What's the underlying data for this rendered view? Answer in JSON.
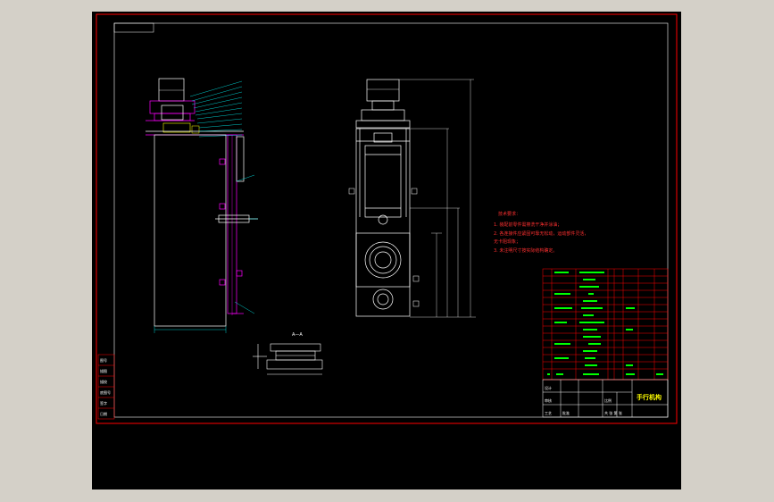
{
  "viewer": {
    "background": "#000000",
    "frame_color": "#ff0000",
    "line_color": "#ffffff",
    "part_color": "#ff00ff",
    "dim_color": "#00ffff",
    "text_green": "#00ff00"
  },
  "section_label": "A—A",
  "notes": {
    "heading": "技术要求：",
    "line1": "1. 装配前零件需擦洗干净并涂油；",
    "line2": "2. 各连接件应紧固可靠无松动，运动部件灵活，",
    "line3": "   无卡阻现象；",
    "line4": "3. 未注明尺寸按实际结构确定。"
  },
  "title_block": {
    "title": "手行机构",
    "labels": [
      "设计",
      "审核",
      "工艺",
      "批准"
    ],
    "scale_label": "比例",
    "sheet_label": "共 张 第 张"
  },
  "left_strip": [
    "图号",
    "描图",
    "描校",
    "底图号",
    "签字",
    "日期"
  ]
}
